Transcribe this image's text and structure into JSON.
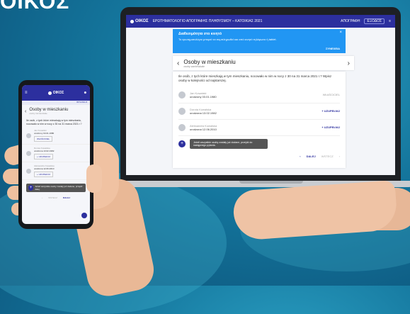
{
  "brand": {
    "text": "ΟΙΚΟΣ"
  },
  "laptop": {
    "appbar": {
      "logo_text": "ΟΙΚΟΣ",
      "title": "ΕΡΩΤΗΜΑΤΟΛΟΓΙΟ ΑΠΟΓΡΑΦΗΣ ΠΛΗΘΥΣΜΟΥ – ΚΑΤΟΙΚΙΑΣ 2021",
      "user": "ΑΠΟΓΡΑΦΗ",
      "chip": "ΕΞΟΔΟΣ",
      "more": "≡"
    },
    "banner": {
      "title": "Διαθεσιμότητα στο κινητό",
      "text": "Το ερωτηματολόγιο μπορεί να συμπληρωθεί και από κινητό τηλέφωνο ή tablet.",
      "action": "ΣΥΝΕΧΕΙΑ",
      "close": "×"
    },
    "header": {
      "back": "‹",
      "forward": "›",
      "title": "Osoby w mieszkaniu",
      "subtitle": "osoby zamieszkałe"
    },
    "question": "Ile osób, z tych które mieszkają w tym mieszkaniu, nocowało w nim w nocy z 30 na 31 marca 2021 r.? Wpisz osoby w kolejności od najstarszej.",
    "people": [
      {
        "name": "Jan Kowalski",
        "detail": "urodzony 03.01.1980",
        "action": "WŁAŚCICIEL",
        "action_muted": true
      },
      {
        "name": "Dorota Kowalska",
        "detail": "urodzona 13.02.1982",
        "action": "+ UZUPEŁNIJ",
        "action_muted": false
      },
      {
        "name": "Aleksandra Kowalska",
        "detail": "urodzona 12.06.2010",
        "action": "+ UZUPEŁNIJ",
        "action_muted": false
      }
    ],
    "add_button": "+",
    "toast": "Jeżeli wszystkie osoby zostały już dodane, przejdź do następnego pytania.",
    "footer": {
      "prev_arrow": "‹",
      "next": "DALEJ",
      "back": "WSTECZ",
      "next_arrow": "›"
    }
  },
  "phone": {
    "topbar": {
      "menu": "≡",
      "logo_text": "ΟΙΚΟΣ",
      "user": "☻"
    },
    "subbar": "WYLOGUJ",
    "header": {
      "back": "‹",
      "title": "Osoby w mieszkaniu",
      "subtitle": "osoby zamieszkałe"
    },
    "question": "Ile osób, z tych które mieszkają w tym mieszkaniu, nocowało w nim w nocy z 30 na 31 marca 2021 r.?",
    "people": [
      {
        "name": "Jan Kowalski",
        "detail": "urodzony 03.01.1980",
        "button": "WŁAŚCICIEL"
      },
      {
        "name": "Dorota Kowalska",
        "detail": "urodzona 13.02.1982",
        "button": "+ UZUPEŁNIJ"
      },
      {
        "name": "Aleksandra Kowalska",
        "detail": "urodzona 12.06.2010",
        "button": "+ UZUPEŁNIJ"
      }
    ],
    "toast": "Jeżeli wszystkie osoby zostały już dodane, przejdź dalej.",
    "footer": {
      "prev": "‹",
      "back": "WSTECZ",
      "next": "DALEJ"
    }
  }
}
